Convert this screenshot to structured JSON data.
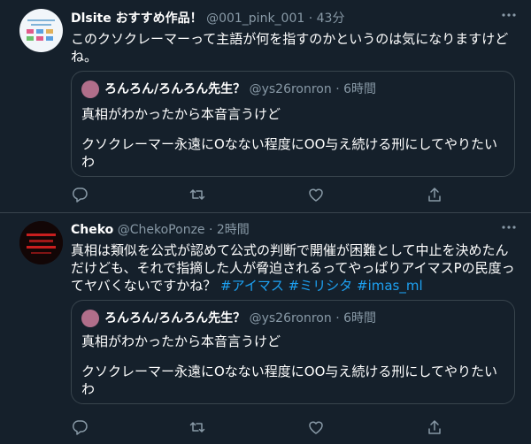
{
  "tweets": [
    {
      "name": "Dlsite おすすめ作品！",
      "handle": "@001_pink_001",
      "sep": "·",
      "time": "43分",
      "text": "このクソクレーマーって主語が何を指すのかというのは気になりますけどね。",
      "quote": {
        "name": "ろんろん/ろんろん先生？",
        "handle": "@ys26ronron",
        "sep": "·",
        "time": "6時間",
        "line1": "真相がわかったから本音言うけど",
        "line2": "クソクレーマー永遠にOなない程度にOO与え続ける刑にしてやりたいわ"
      }
    },
    {
      "name": "Cheko",
      "handle": "@ChekoPonze",
      "sep": "·",
      "time": "2時間",
      "text": "真相は類似を公式が認めて公式の判断で開催が困難として中止を決めたんだけども、それで指摘した人が脅迫されるってやっぱりアイマスPの民度ってヤバくないですかね？ ",
      "hashtags": [
        "#アイマス",
        "#ミリシタ",
        "#imas_ml"
      ],
      "quote": {
        "name": "ろんろん/ろんろん先生？",
        "handle": "@ys26ronron",
        "sep": "·",
        "time": "6時間",
        "line1": "真相がわかったから本音言うけど",
        "line2": "クソクレーマー永遠にOなない程度にOO与え続ける刑にしてやりたいわ"
      }
    }
  ],
  "icons": [
    "more-icon",
    "reply-icon",
    "retweet-icon",
    "like-icon",
    "share-icon"
  ],
  "colors": {
    "background": "#15202b",
    "muted": "#8899a6",
    "link": "#1da1f2",
    "border": "#38444d"
  }
}
